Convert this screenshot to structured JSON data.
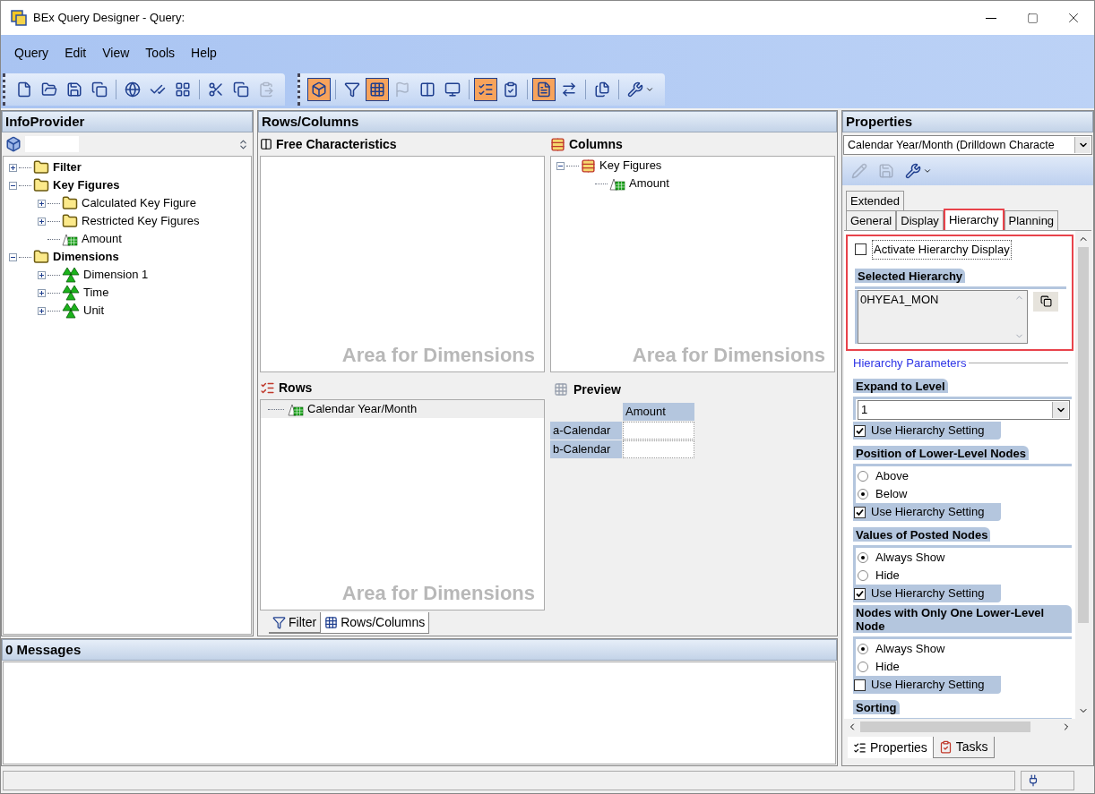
{
  "window": {
    "title": "BEx Query Designer - Query:"
  },
  "menu": [
    "Query",
    "Edit",
    "View",
    "Tools",
    "Help"
  ],
  "toolbar": [
    [
      {
        "kind": "new",
        "pressed": false,
        "disabled": false
      },
      {
        "kind": "open",
        "pressed": false,
        "disabled": false
      },
      {
        "kind": "save",
        "pressed": false,
        "disabled": false
      },
      {
        "kind": "save_all",
        "pressed": false,
        "disabled": false
      },
      {
        "kind": "sep"
      },
      {
        "kind": "globe",
        "pressed": false,
        "disabled": false
      },
      {
        "kind": "check",
        "pressed": false,
        "disabled": false
      },
      {
        "kind": "grid",
        "pressed": false,
        "disabled": false
      },
      {
        "kind": "sep"
      },
      {
        "kind": "cut",
        "pressed": false,
        "disabled": false
      },
      {
        "kind": "copy",
        "pressed": false,
        "disabled": false
      },
      {
        "kind": "paste",
        "pressed": false,
        "disabled": true
      }
    ],
    [
      {
        "kind": "cube",
        "pressed": true,
        "disabled": false
      },
      {
        "kind": "sep"
      },
      {
        "kind": "filter",
        "pressed": false,
        "disabled": false
      },
      {
        "kind": "table",
        "pressed": true,
        "disabled": false
      },
      {
        "kind": "flag",
        "pressed": false,
        "disabled": true
      },
      {
        "kind": "columns",
        "pressed": false,
        "disabled": false
      },
      {
        "kind": "monitor",
        "pressed": false,
        "disabled": false
      },
      {
        "kind": "sep"
      },
      {
        "kind": "list",
        "pressed": true,
        "disabled": false
      },
      {
        "kind": "tasks",
        "pressed": false,
        "disabled": false
      },
      {
        "kind": "sep"
      },
      {
        "kind": "document",
        "pressed": true,
        "disabled": false
      },
      {
        "kind": "arrows",
        "pressed": false,
        "disabled": false
      },
      {
        "kind": "sep"
      },
      {
        "kind": "pages",
        "pressed": false,
        "disabled": false
      },
      {
        "kind": "sep"
      },
      {
        "kind": "tools",
        "pressed": false,
        "disabled": false
      }
    ]
  ],
  "info_provider": {
    "title": "InfoProvider",
    "tree": [
      {
        "label": "Filter",
        "kind": "folder",
        "expanded": false
      },
      {
        "label": "Key Figures",
        "kind": "folder",
        "expanded": true,
        "children": [
          {
            "label": "Calculated Key Figure",
            "kind": "folder",
            "expanded": false
          },
          {
            "label": "Restricted Key Figures",
            "kind": "folder",
            "expanded": false
          },
          {
            "label": "Amount",
            "kind": "key_figure"
          }
        ]
      },
      {
        "label": "Dimensions",
        "kind": "folder",
        "expanded": true,
        "children": [
          {
            "label": "Dimension 1",
            "kind": "dimension",
            "expanded": false
          },
          {
            "label": "Time",
            "kind": "dimension",
            "expanded": false
          },
          {
            "label": "Unit",
            "kind": "dimension",
            "expanded": false
          }
        ]
      }
    ]
  },
  "rows_columns": {
    "title": "Rows/Columns",
    "free_characteristics": {
      "title": "Free Characteristics",
      "watermark": "Area for Dimensions"
    },
    "columns": {
      "title": "Columns",
      "watermark": "Area for Dimensions",
      "tree": [
        {
          "label": "Key Figures",
          "kind": "structure",
          "expanded": true,
          "children": [
            {
              "label": "Amount",
              "kind": "key_figure"
            }
          ]
        }
      ]
    },
    "rows": {
      "title": "Rows",
      "watermark": "Area for Dimensions",
      "items": [
        {
          "label": "Calendar Year/Month",
          "selected": true
        }
      ]
    },
    "preview": {
      "title": "Preview",
      "column": "Amount",
      "rows": [
        "a-Calendar",
        "b-Calendar"
      ]
    },
    "tabs": [
      {
        "label": "Filter",
        "selected": false
      },
      {
        "label": "Rows/Columns",
        "selected": true
      }
    ]
  },
  "messages": {
    "title": "0 Messages"
  },
  "properties": {
    "title": "Properties",
    "object": "Calendar Year/Month (Drilldown Characte",
    "toolbar": [
      {
        "kind": "edit",
        "disabled": true
      },
      {
        "kind": "save",
        "disabled": true
      },
      {
        "kind": "tools",
        "disabled": false
      }
    ],
    "tab_rows": [
      [
        {
          "label": "Extended",
          "selected": false,
          "highlighted": false
        }
      ],
      [
        {
          "label": "General",
          "selected": false,
          "highlighted": false
        },
        {
          "label": "Display",
          "selected": false,
          "highlighted": false
        },
        {
          "label": "Hierarchy",
          "selected": true,
          "highlighted": true
        },
        {
          "label": "Planning",
          "selected": false,
          "highlighted": false
        }
      ]
    ],
    "hierarchy_box_highlighted": true,
    "activate": {
      "label": "Activate Hierarchy Display",
      "checked": false
    },
    "selected_hierarchy": {
      "title": "Selected Hierarchy",
      "value": "0HYEA1_MON"
    },
    "parameters_title": "Hierarchy Parameters",
    "sections": [
      {
        "title": "Expand to Level",
        "kind": "dropdown",
        "value": "1",
        "use_setting": {
          "label": "Use Hierarchy Setting",
          "checked": true
        }
      },
      {
        "title": "Position of Lower-Level Nodes",
        "kind": "radio",
        "options": [
          {
            "label": "Above",
            "selected": false
          },
          {
            "label": "Below",
            "selected": true
          }
        ],
        "use_setting": {
          "label": "Use Hierarchy Setting",
          "checked": true
        }
      },
      {
        "title": "Values of Posted Nodes",
        "kind": "radio",
        "options": [
          {
            "label": "Always Show",
            "selected": true
          },
          {
            "label": "Hide",
            "selected": false
          }
        ],
        "use_setting": {
          "label": "Use Hierarchy Setting",
          "checked": true
        }
      },
      {
        "title": "Nodes with Only One Lower-Level Node",
        "kind": "radio",
        "options": [
          {
            "label": "Always Show",
            "selected": true
          },
          {
            "label": "Hide",
            "selected": false
          }
        ],
        "use_setting": {
          "label": "Use Hierarchy Setting",
          "checked": false
        }
      },
      {
        "title": "Sorting",
        "kind": "heading"
      }
    ],
    "bottom_tabs": [
      {
        "label": "Properties",
        "kind": "properties",
        "selected": true
      },
      {
        "label": "Tasks",
        "kind": "tasks",
        "selected": false
      }
    ]
  }
}
